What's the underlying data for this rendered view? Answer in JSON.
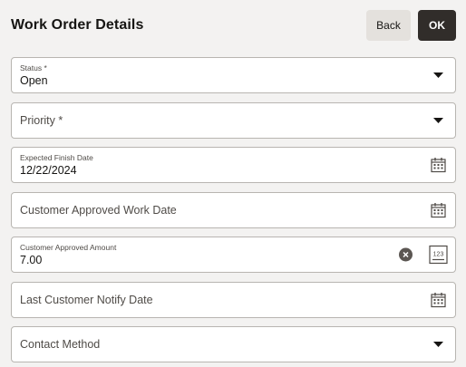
{
  "header": {
    "title": "Work Order Details",
    "back_label": "Back",
    "ok_label": "OK"
  },
  "fields": {
    "status": {
      "label": "Status *",
      "value": "Open",
      "icon": "chevron-down-icon"
    },
    "priority": {
      "placeholder": "Priority *",
      "icon": "chevron-down-icon"
    },
    "expected_finish_date": {
      "label": "Expected Finish Date",
      "value": "12/22/2024",
      "icon": "calendar-icon"
    },
    "customer_approved_work_date": {
      "placeholder": "Customer Approved Work Date",
      "icon": "calendar-icon"
    },
    "customer_approved_amount": {
      "label": "Customer Approved Amount",
      "value": "7.00",
      "icons": [
        "clear-icon",
        "number-keypad-icon"
      ],
      "keypad_text": "123"
    },
    "last_customer_notify_date": {
      "placeholder": "Last Customer Notify Date",
      "icon": "calendar-icon"
    },
    "contact_method": {
      "placeholder": "Contact Method",
      "icon": "chevron-down-icon"
    }
  },
  "colors": {
    "background": "#f3f2f1",
    "field_border": "#b8b5b1",
    "primary_button": "#312d2a",
    "secondary_button": "#e4e1dd"
  }
}
